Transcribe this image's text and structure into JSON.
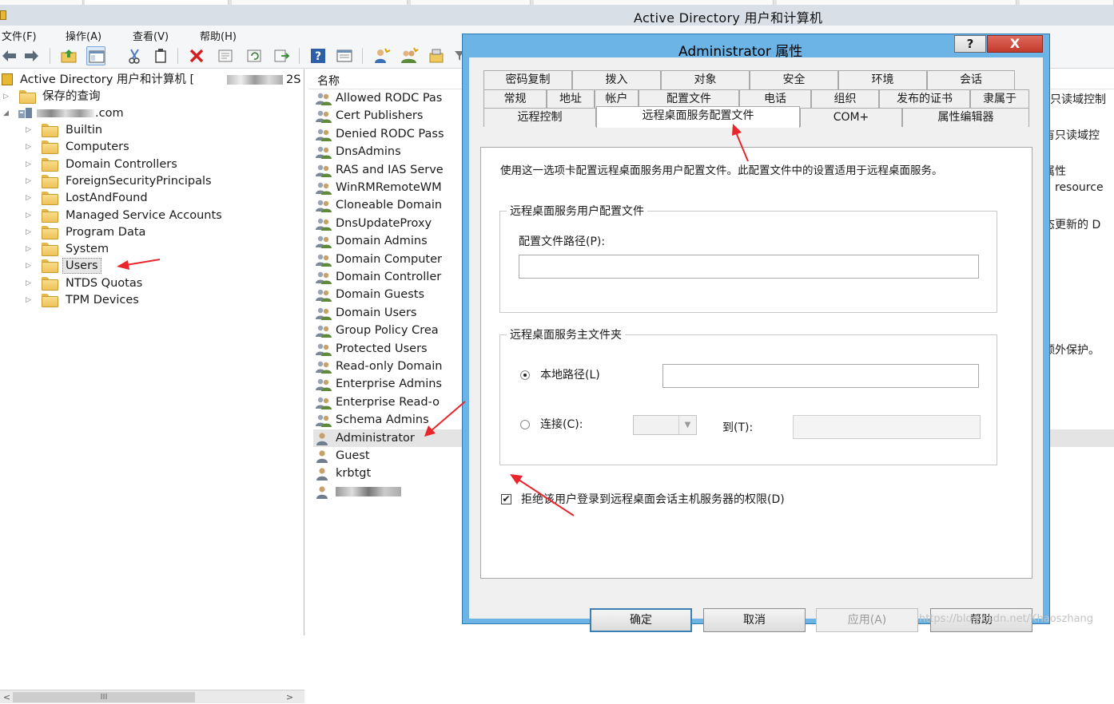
{
  "window": {
    "title": "Active Directory 用户和计算机"
  },
  "menu": [
    "文件(F)",
    "操作(A)",
    "查看(V)",
    "帮助(H)"
  ],
  "toolbar": {
    "icons": [
      "back-arrow-icon",
      "forward-arrow-icon",
      "up-folder-icon",
      "show-console-tree-icon",
      "cut-icon",
      "copy-icon",
      "delete-icon",
      "properties-icon",
      "refresh-icon",
      "export-list-icon",
      "help-icon",
      "details-view-icon",
      "new-user-icon",
      "new-group-icon",
      "new-ou-icon",
      "filter-icon"
    ]
  },
  "tree": {
    "root": "Active Directory 用户和计算机 [",
    "root_suffix": "2S",
    "saved_queries": "保存的查询",
    "domain": ".com",
    "items": [
      "Builtin",
      "Computers",
      "Domain Controllers",
      "ForeignSecurityPrincipals",
      "LostAndFound",
      "Managed Service Accounts",
      "Program Data",
      "System",
      "Users",
      "NTDS Quotas",
      "TPM Devices"
    ],
    "selected": "Users",
    "scroll_thumb": "III"
  },
  "list": {
    "column_name": "名称",
    "groups": [
      "Allowed RODC Pas",
      "Cert Publishers",
      "Denied RODC Pass",
      "DnsAdmins",
      "RAS and IAS Serve",
      "WinRMRemoteWM",
      "Cloneable Domain",
      "DnsUpdateProxy",
      "Domain Admins",
      "Domain Computer",
      "Domain Controller",
      "Domain Guests",
      "Domain Users",
      "Group Policy Crea",
      "Protected Users",
      "Read-only Domain",
      "Enterprise Admins",
      "Enterprise Read-o",
      "Schema Admins"
    ],
    "users": [
      "Administrator",
      "Guest",
      "krbtgt"
    ],
    "selected": "Administrator",
    "descriptions": [
      "只读域控制",
      "有只读域控",
      "属性",
      "resource",
      "态更新的 D",
      "额外保护。"
    ]
  },
  "dialog": {
    "title": "Administrator 属性",
    "help_glyph": "?",
    "close_glyph": "X",
    "tabs_row1": [
      "密码复制",
      "拨入",
      "对象",
      "安全",
      "环境",
      "会话"
    ],
    "tabs_row2": [
      "常规",
      "地址",
      "帐户",
      "配置文件",
      "电话",
      "组织",
      "发布的证书",
      "隶属于"
    ],
    "tabs_row3": [
      "远程控制",
      "远程桌面服务配置文件",
      "COM+",
      "属性编辑器"
    ],
    "active_tab": "远程桌面服务配置文件",
    "intro_text": "使用这一选项卡配置远程桌面服务用户配置文件。此配置文件中的设置适用于远程桌面服务。",
    "profile_group": "远程桌面服务用户配置文件",
    "profile_path_label": "配置文件路径(P):",
    "profile_path_value": "",
    "home_group": "远程桌面服务主文件夹",
    "local_path_label": "本地路径(L)",
    "local_path_value": "",
    "local_path_selected": true,
    "connect_label": "连接(C):",
    "to_label": "到(T):",
    "deny_checkbox_label": "拒绝该用户登录到远程桌面会话主机服务器的权限(D)",
    "deny_checked": true,
    "check_glyph": "✔",
    "buttons": {
      "ok": "确定",
      "cancel": "取消",
      "apply": "应用(A)",
      "help": "帮助"
    }
  },
  "annotation_color": "#e8262b",
  "watermark": "https://blog.csdn.net/Khaoszhang"
}
